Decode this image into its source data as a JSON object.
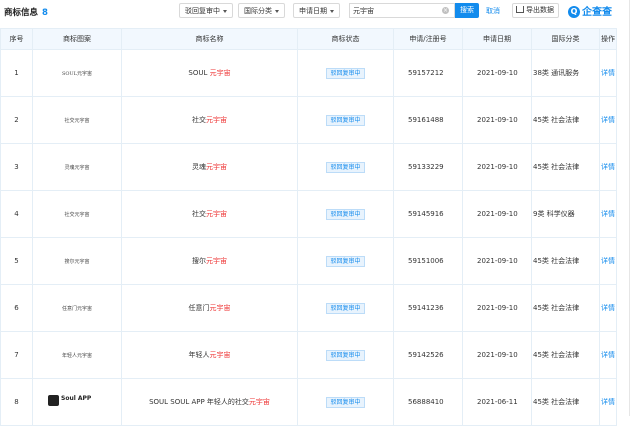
{
  "header": {
    "title": "商标信息",
    "count": "8",
    "filter_status": "驳回复审中",
    "filter_class": "国际分类",
    "filter_date": "申请日期",
    "search_value": "元宇宙",
    "search_label": "搜索",
    "cancel_label": "取消",
    "export_label": "导出数据",
    "logo": "企查查"
  },
  "table": {
    "columns": [
      "序号",
      "商标图案",
      "商标名称",
      "商标状态",
      "申请/注册号",
      "申请日期",
      "国际分类",
      "操作"
    ],
    "rows": [
      {
        "idx": "1",
        "image_text": "SOUL元宇宙",
        "name_pre": "SOUL ",
        "name_hl": "元宇宙",
        "status": "驳回复审中",
        "number": "59157212",
        "date": "2021-09-10",
        "cls": "38类 通讯服务",
        "action": "详情"
      },
      {
        "idx": "2",
        "image_text": "社交元宇宙",
        "name_pre": "社交",
        "name_hl": "元宇宙",
        "status": "驳回复审中",
        "number": "59161488",
        "date": "2021-09-10",
        "cls": "45类 社会法律",
        "action": "详情"
      },
      {
        "idx": "3",
        "image_text": "灵魂元宇宙",
        "name_pre": "灵魂",
        "name_hl": "元宇宙",
        "status": "驳回复审中",
        "number": "59133229",
        "date": "2021-09-10",
        "cls": "45类 社会法律",
        "action": "详情"
      },
      {
        "idx": "4",
        "image_text": "社交元宇宙",
        "name_pre": "社交",
        "name_hl": "元宇宙",
        "status": "驳回复审中",
        "number": "59145916",
        "date": "2021-09-10",
        "cls": "9类 科学仪器",
        "action": "详情"
      },
      {
        "idx": "5",
        "image_text": "搜尔元宇宙",
        "name_pre": "搜尔",
        "name_hl": "元宇宙",
        "status": "驳回复审中",
        "number": "59151006",
        "date": "2021-09-10",
        "cls": "45类 社会法律",
        "action": "详情"
      },
      {
        "idx": "6",
        "image_text": "任意门元宇宙",
        "name_pre": "任意门",
        "name_hl": "元宇宙",
        "status": "驳回复审中",
        "number": "59141236",
        "date": "2021-09-10",
        "cls": "45类 社会法律",
        "action": "详情"
      },
      {
        "idx": "7",
        "image_text": "年轻人元宇宙",
        "name_pre": "年轻人",
        "name_hl": "元宇宙",
        "status": "驳回复审中",
        "number": "59142526",
        "date": "2021-09-10",
        "cls": "45类 社会法律",
        "action": "详情"
      },
      {
        "idx": "8",
        "image_text": "Soul APP",
        "name_pre": "SOUL SOUL APP 年轻人的社交",
        "name_hl": "元宇宙",
        "status": "驳回复审中",
        "number": "56888410",
        "date": "2021-06-11",
        "cls": "45类 社会法律",
        "action": "详情"
      }
    ]
  },
  "colors": {
    "accent": "#128bed",
    "highlight": "#ee3333",
    "header_bg": "#f2f8fe"
  }
}
